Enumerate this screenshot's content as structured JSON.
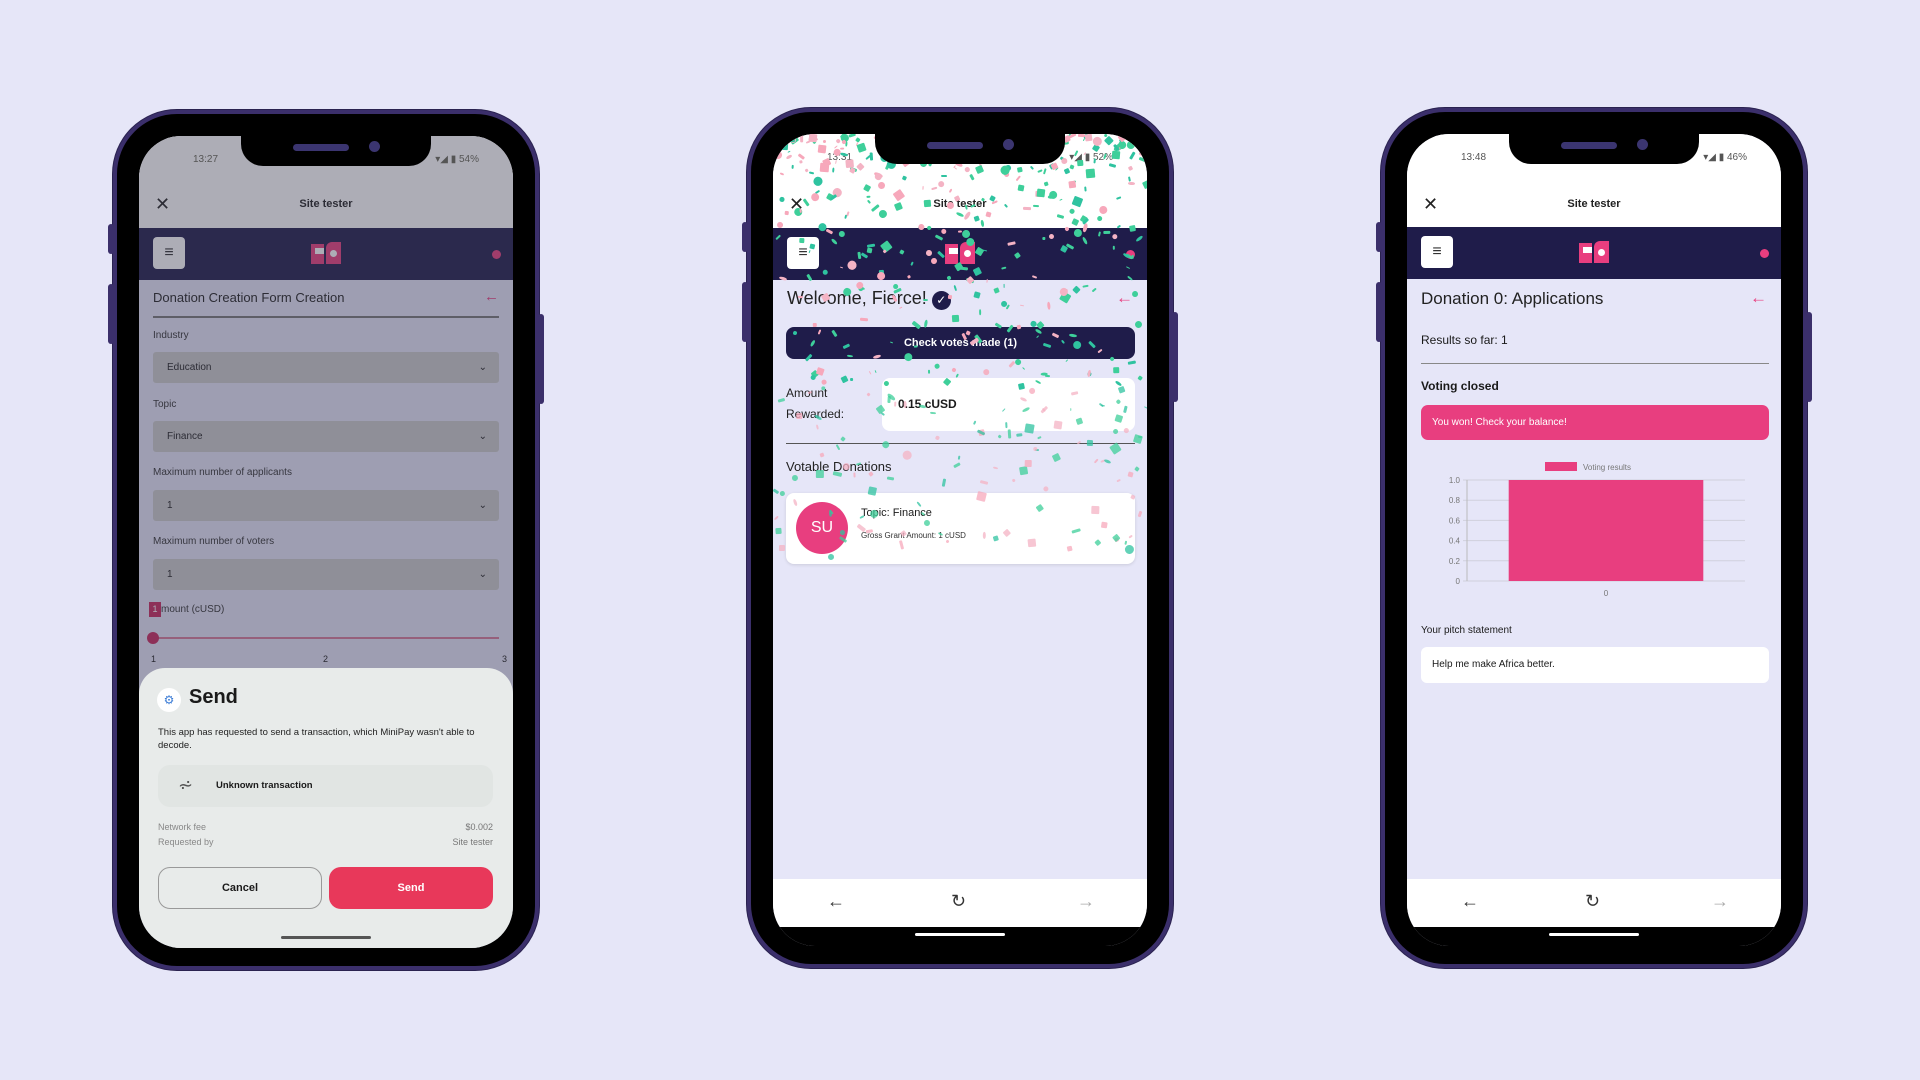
{
  "colors": {
    "background": "#e6e6f8",
    "nav": "#1f1c4a",
    "accent": "#e83e7f",
    "send": "#e8385a"
  },
  "browser": {
    "title": "Site tester",
    "close_icon": "close-icon",
    "back": "←",
    "reload": "↻",
    "forward": "→"
  },
  "phone1": {
    "status": {
      "time": "13:27",
      "battery": "54%"
    },
    "page_title": "Donation Creation Form Creation",
    "fields": [
      {
        "label": "Industry",
        "value": "Education"
      },
      {
        "label": "Topic",
        "value": "Finance"
      },
      {
        "label": "Maximum number of applicants",
        "value": "1"
      },
      {
        "label": "Maximum number of voters",
        "value": "1"
      }
    ],
    "amount": {
      "label": "mount (cUSD)",
      "badge": "1",
      "min": "1",
      "mid": "2",
      "max": "3",
      "value": 1
    },
    "sheet": {
      "title": "Send",
      "description": "This app has requested to send a transaction, which MiniPay wasn't able to decode.",
      "transaction": "Unknown transaction",
      "network_fee_label": "Network fee",
      "network_fee": "$0.002",
      "requested_by_label": "Requested by",
      "requested_by": "Site tester",
      "cancel": "Cancel",
      "send": "Send"
    }
  },
  "phone2": {
    "status": {
      "time": "13:31",
      "battery": "52%"
    },
    "welcome": "Welcome, Fierce!",
    "check_votes": "Check votes made (1)",
    "amount_label_1": "Amount",
    "amount_label_2": "Rewarded:",
    "amount_value": "0.15 cUSD",
    "section": "Votable Donations",
    "card": {
      "avatar": "SU",
      "topic": "Topic: Finance",
      "gross": "Gross Grant Amount: 1 cUSD"
    }
  },
  "phone3": {
    "status": {
      "time": "13:48",
      "battery": "46%"
    },
    "page_title": "Donation 0: Applications",
    "results": "Results so far: 1",
    "voting_status": "Voting closed",
    "banner": "You won! Check your balance!",
    "pitch_label": "Your pitch statement",
    "pitch_value": "Help me make Africa better."
  },
  "chart_data": {
    "type": "bar",
    "categories": [
      "0"
    ],
    "series": [
      {
        "name": "Voting results",
        "values": [
          1
        ]
      }
    ],
    "ylim": [
      0,
      1
    ],
    "yticks": [
      "0",
      "0.2",
      "0.4",
      "0.6",
      "0.8",
      "1.0"
    ],
    "grid": true,
    "legend": "top",
    "color": "#e83e7f"
  }
}
